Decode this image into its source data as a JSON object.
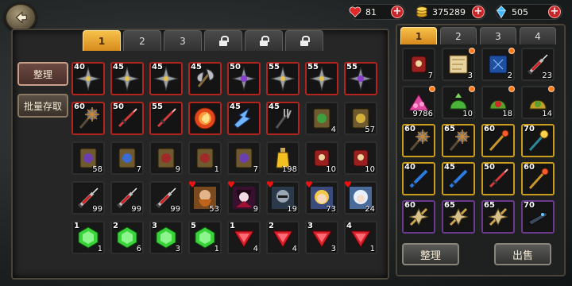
{
  "currencies": {
    "hearts": "81",
    "coins": "375289",
    "gems": "505"
  },
  "left_tabs": [
    "1",
    "2",
    "3"
  ],
  "left_locked_tab_count": 3,
  "side_buttons": {
    "sort": "整理",
    "batch_store": "批量存取"
  },
  "grid": [
    [
      {
        "lvl": "40",
        "icon": "shuriken",
        "border": "red"
      },
      {
        "lvl": "45",
        "icon": "shuriken",
        "border": "red"
      },
      {
        "lvl": "45",
        "icon": "shuriken",
        "border": "red"
      },
      {
        "lvl": "45",
        "icon": "axe",
        "border": "red"
      },
      {
        "lvl": "50",
        "icon": "shuriken-purple",
        "border": "red"
      },
      {
        "lvl": "55",
        "icon": "shuriken",
        "border": "red"
      },
      {
        "lvl": "55",
        "icon": "shuriken",
        "border": "red"
      },
      {
        "lvl": "55",
        "icon": "shuriken-purple",
        "border": "red"
      }
    ],
    [
      {
        "lvl": "60",
        "icon": "mace",
        "border": "red"
      },
      {
        "lvl": "50",
        "icon": "dagger-red",
        "border": "red"
      },
      {
        "lvl": "55",
        "icon": "dagger-red",
        "border": "red"
      },
      {
        "lvl": "",
        "icon": "fire-orb",
        "border": "red"
      },
      {
        "lvl": "45",
        "icon": "lightning-claw",
        "border": "red"
      },
      {
        "lvl": "45",
        "icon": "fork",
        "border": "red"
      },
      {
        "lvl": "",
        "icon": "book-green",
        "count": "4",
        "border": "plain"
      },
      {
        "lvl": "",
        "icon": "book-gold",
        "count": "57",
        "border": "plain"
      }
    ],
    [
      {
        "lvl": "",
        "icon": "book-purple",
        "count": "58",
        "border": "plain"
      },
      {
        "lvl": "",
        "icon": "book-blue",
        "count": "7",
        "border": "plain"
      },
      {
        "lvl": "",
        "icon": "book-red",
        "count": "9",
        "border": "plain"
      },
      {
        "lvl": "",
        "icon": "book-red",
        "count": "1",
        "border": "plain"
      },
      {
        "lvl": "",
        "icon": "book-purple",
        "count": "7",
        "border": "plain"
      },
      {
        "lvl": "",
        "icon": "potion",
        "count": "198",
        "border": "plain"
      },
      {
        "lvl": "",
        "icon": "scroll-red",
        "count": "10",
        "border": "plain"
      },
      {
        "lvl": "",
        "icon": "scroll-red",
        "count": "10",
        "border": "plain"
      }
    ],
    [
      {
        "lvl": "",
        "icon": "syringe",
        "count": "99",
        "border": "plain"
      },
      {
        "lvl": "",
        "icon": "syringe",
        "count": "99",
        "border": "plain"
      },
      {
        "lvl": "",
        "icon": "syringe",
        "count": "99",
        "border": "plain"
      },
      {
        "lvl": "",
        "icon": "hero-dwarf",
        "count": "53",
        "border": "plain",
        "heart": true
      },
      {
        "lvl": "",
        "icon": "hero-vampire",
        "count": "9",
        "border": "plain",
        "heart": true
      },
      {
        "lvl": "",
        "icon": "hero-knight",
        "count": "19",
        "border": "plain",
        "heart": true
      },
      {
        "lvl": "",
        "icon": "hero-blonde",
        "count": "73",
        "border": "plain",
        "heart": true
      },
      {
        "lvl": "",
        "icon": "hero-ice",
        "count": "24",
        "border": "plain",
        "heart": true
      }
    ],
    [
      {
        "lvl": "1",
        "icon": "gem-green",
        "count": "1",
        "border": "plain"
      },
      {
        "lvl": "2",
        "icon": "gem-green",
        "count": "6",
        "border": "plain"
      },
      {
        "lvl": "3",
        "icon": "gem-green",
        "count": "3",
        "border": "plain"
      },
      {
        "lvl": "5",
        "icon": "gem-green",
        "count": "1",
        "border": "plain"
      },
      {
        "lvl": "1",
        "icon": "gem-red",
        "count": "4",
        "border": "plain"
      },
      {
        "lvl": "2",
        "icon": "gem-red",
        "count": "4",
        "border": "plain"
      },
      {
        "lvl": "3",
        "icon": "gem-red",
        "count": "3",
        "border": "plain"
      },
      {
        "lvl": "4",
        "icon": "gem-red",
        "count": "1",
        "border": "plain"
      }
    ]
  ],
  "right_tabs": [
    "1",
    "2",
    "3",
    "4"
  ],
  "right_grid": [
    [
      {
        "lvl": "",
        "icon": "scroll-red",
        "count": "7",
        "border": "plain"
      },
      {
        "lvl": "",
        "icon": "map-scroll",
        "count": "3",
        "border": "plain",
        "dot": true
      },
      {
        "lvl": "",
        "icon": "spellbook",
        "count": "2",
        "border": "plain",
        "dot": true
      },
      {
        "lvl": "",
        "icon": "syringe",
        "count": "23",
        "border": "plain"
      }
    ],
    [
      {
        "lvl": "",
        "icon": "gem-pile",
        "count": "9786",
        "border": "plain",
        "dot": true
      },
      {
        "lvl": "",
        "icon": "leaf-bag",
        "count": "10",
        "border": "plain",
        "dot": true
      },
      {
        "lvl": "",
        "icon": "candy-bag",
        "count": "18",
        "border": "plain",
        "dot": true
      },
      {
        "lvl": "",
        "icon": "gold-bag",
        "count": "14",
        "border": "plain",
        "dot": true
      }
    ],
    [
      {
        "lvl": "60",
        "icon": "mace",
        "border": "yellow"
      },
      {
        "lvl": "65",
        "icon": "mace",
        "border": "yellow"
      },
      {
        "lvl": "60",
        "icon": "staff-gold",
        "border": "yellow"
      },
      {
        "lvl": "70",
        "icon": "staff-blue",
        "border": "yellow"
      }
    ],
    [
      {
        "lvl": "40",
        "icon": "sword-blue",
        "border": "yellow"
      },
      {
        "lvl": "45",
        "icon": "sword-blue",
        "border": "yellow"
      },
      {
        "lvl": "50",
        "icon": "dagger-red",
        "border": "yellow"
      },
      {
        "lvl": "60",
        "icon": "staff-gold",
        "border": "yellow"
      }
    ],
    [
      {
        "lvl": "60",
        "icon": "shuriken-gold",
        "border": "purple"
      },
      {
        "lvl": "65",
        "icon": "shuriken-gold",
        "border": "purple"
      },
      {
        "lvl": "65",
        "icon": "shuriken-gold",
        "border": "purple"
      },
      {
        "lvl": "70",
        "icon": "gun-dark",
        "border": "purple"
      }
    ]
  ],
  "right_buttons": {
    "sort": "整理",
    "sell": "出售"
  },
  "colors": {
    "red_border": "#b3241f",
    "yellow_border": "#c99b1e",
    "purple_border": "#6b3a8f",
    "tab_active": "#f0ac33"
  }
}
